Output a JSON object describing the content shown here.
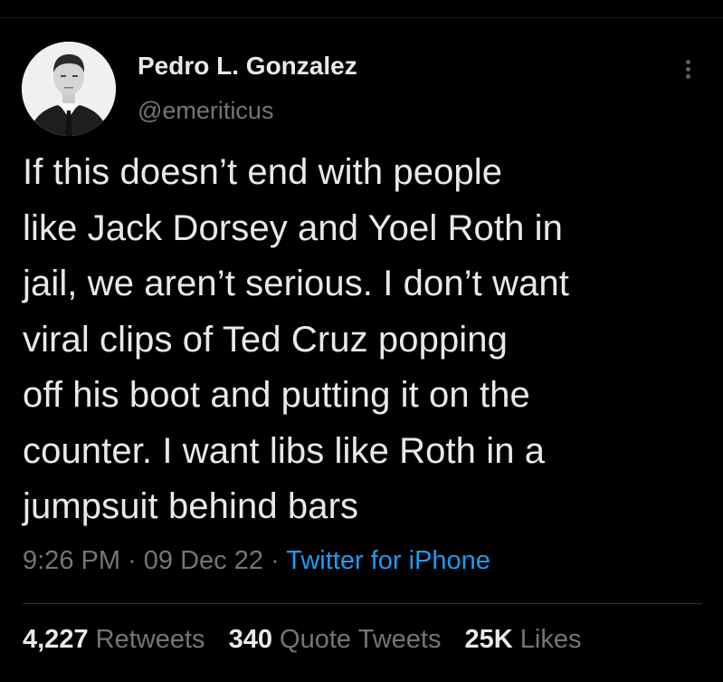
{
  "author": {
    "display_name": "Pedro L. Gonzalez",
    "handle": "@emeriticus",
    "avatar_icon": "profile-photo-man-in-suit"
  },
  "tweet": {
    "text_lines": [
      "If this doesn’t end with people",
      "like Jack Dorsey and Yoel Roth in",
      "jail, we aren’t serious. I don’t want",
      "viral clips of Ted Cruz popping",
      "off his boot and putting it on the",
      "counter. I want libs like Roth in a",
      "jumpsuit behind bars"
    ],
    "time": "9:26 PM",
    "date": "09 Dec 22",
    "separator": " · ",
    "source": "Twitter for iPhone"
  },
  "stats": {
    "retweets_count": "4,227",
    "retweets_label": "Retweets",
    "quotes_count": "340",
    "quotes_label": "Quote Tweets",
    "likes_count": "25K",
    "likes_label": "Likes"
  },
  "colors": {
    "background": "#000000",
    "text_primary": "#e7e9ea",
    "text_secondary": "#71767b",
    "link": "#1d9bf0",
    "divider": "#2f3336"
  },
  "icons": {
    "more": "more-vertical-icon"
  }
}
